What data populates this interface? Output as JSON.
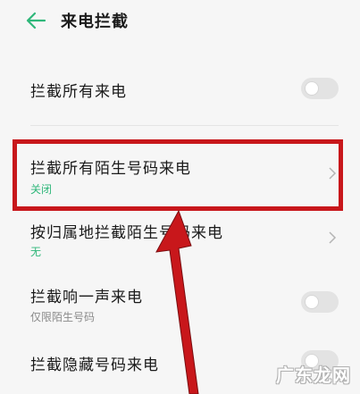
{
  "header": {
    "title": "来电拦截",
    "back_icon": "arrow-left-icon",
    "accent": "#2fb77a"
  },
  "settings": [
    {
      "label": "拦截所有来电",
      "control": "toggle",
      "on": false
    },
    {
      "label": "拦截所有陌生号码来电",
      "sub": "关闭",
      "control": "chevron"
    },
    {
      "label": "按归属地拦截陌生号码来电",
      "sub": "无",
      "control": "chevron"
    },
    {
      "label": "拦截响一声来电",
      "sub": "仅限陌生号码",
      "control": "toggle",
      "on": false
    },
    {
      "label": "拦截隐藏号码来电",
      "control": "toggle",
      "on": false
    }
  ],
  "annotation": {
    "highlight_color": "#c8171b",
    "arrow_color": "#c8171b"
  },
  "watermark": {
    "text": "广东龙网"
  }
}
